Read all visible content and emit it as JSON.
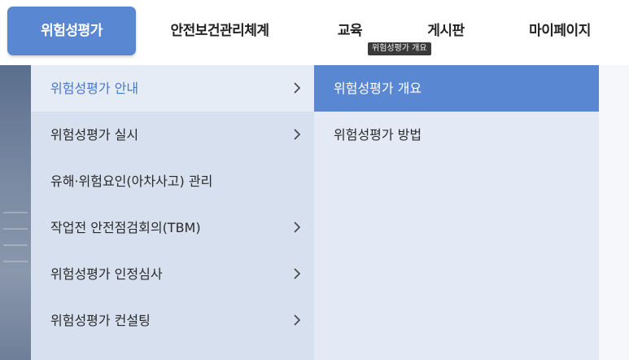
{
  "nav": {
    "items": [
      {
        "label": "위험성평가"
      },
      {
        "label": "안전보건관리체계"
      },
      {
        "label": "교육"
      },
      {
        "label": "게시판"
      },
      {
        "label": "마이페이지"
      }
    ],
    "active_index": 0
  },
  "submenu": {
    "level1": [
      {
        "label": "위험성평가 안내",
        "has_children": true,
        "active": true
      },
      {
        "label": "위험성평가 실시",
        "has_children": true
      },
      {
        "label": "유해·위험요인(아차사고) 관리",
        "has_children": false
      },
      {
        "label": "작업전 안전점검회의(TBM)",
        "has_children": true
      },
      {
        "label": "위험성평가 인정심사",
        "has_children": true
      },
      {
        "label": "위험성평가 컨설팅",
        "has_children": true
      }
    ],
    "level2": [
      {
        "label": "위험성평가 개요",
        "active": true
      },
      {
        "label": "위험성평가 방법"
      }
    ]
  },
  "tooltip": {
    "text": "위험성평가 개요"
  },
  "colors": {
    "accent": "#5a87d2",
    "active_text": "#4a78c6",
    "panel_bg": "#d6e0ef",
    "level2_bg": "#e3eaf6"
  },
  "icons": {
    "submenu_arrow": "chevron-right-icon"
  }
}
